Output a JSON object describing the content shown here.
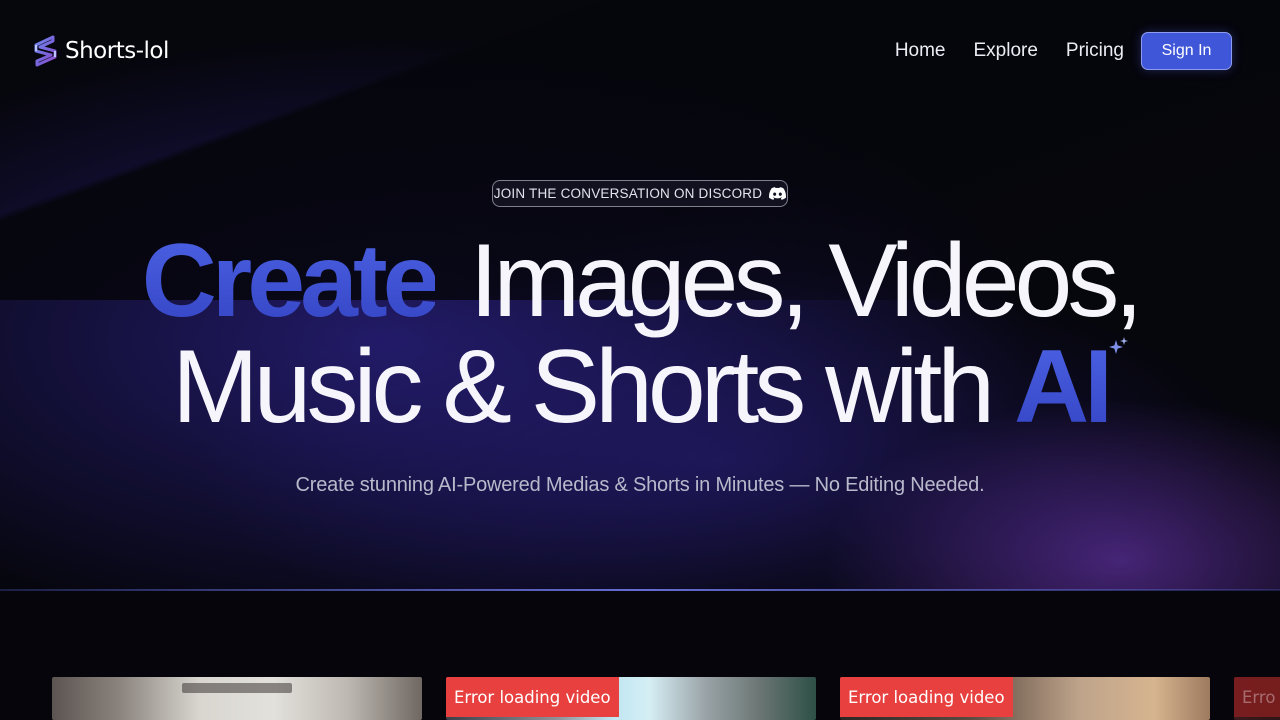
{
  "brand": {
    "name": "Shorts-lol",
    "logo_icon": "shorts-lol-s-logo-icon"
  },
  "nav": {
    "links": [
      "Home",
      "Explore",
      "Pricing"
    ],
    "signin_label": "Sign In"
  },
  "hero": {
    "pill_text": "JOIN THE CONVERSATION ON DISCORD",
    "pill_icon": "discord-icon",
    "headline": {
      "accent_word": "Create",
      "line1_rest": "Images, Videos,",
      "line2_main": "Music & Shorts with",
      "accent_ai": "AI",
      "sparkle_icon": "sparkle-icon"
    },
    "subtitle": "Create stunning AI-Powered Medias & Shorts in Minutes — No Editing Needed."
  },
  "cards": [
    {
      "error": ""
    },
    {
      "error": "Error loading video"
    },
    {
      "error": "Error loading video"
    },
    {
      "error": "Erro"
    }
  ],
  "colors": {
    "accent": "#4256d4",
    "signin_bg": "#3f56d8",
    "error_red": "#e8403f",
    "page_bg": "#05050b"
  }
}
